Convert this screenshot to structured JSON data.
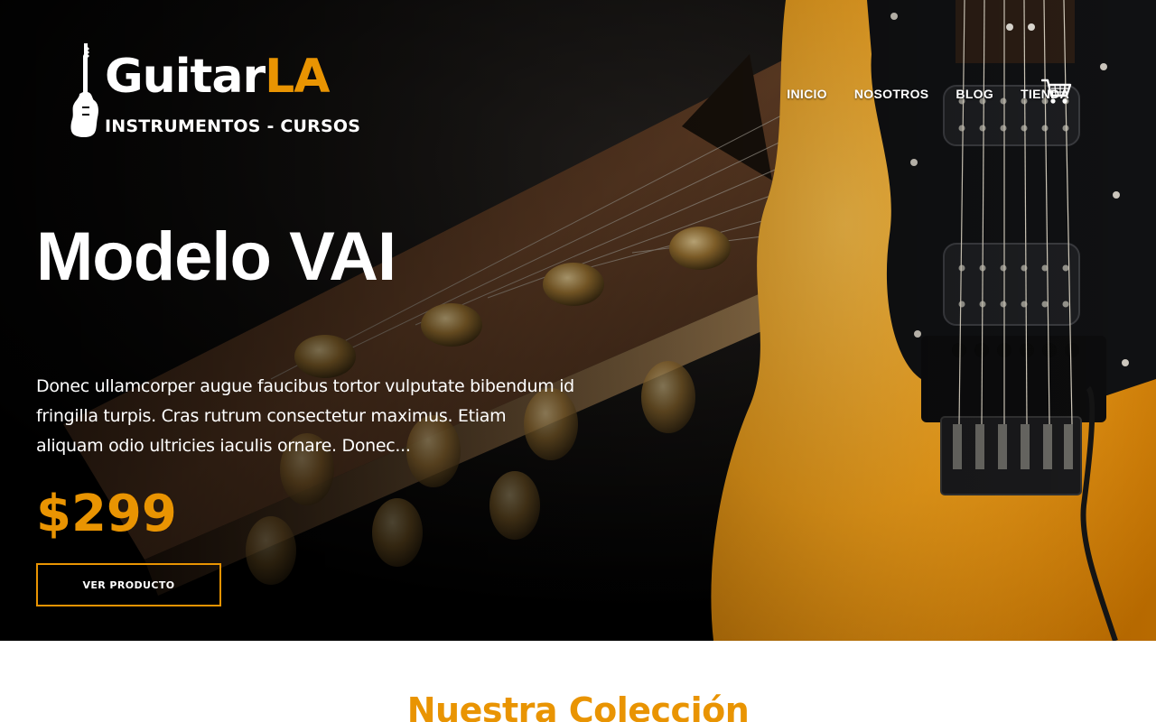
{
  "brand": {
    "name_main": "Guitar",
    "name_accent": "LA",
    "tagline": "INSTRUMENTOS - CURSOS",
    "accent_color": "#e99402",
    "logo_icon": "electric-guitar-icon"
  },
  "nav": {
    "items": [
      {
        "label": "INICIO"
      },
      {
        "label": "NOSOTROS"
      },
      {
        "label": "BLOG"
      },
      {
        "label": "TIENDA"
      }
    ],
    "cart_icon": "shopping-cart-icon"
  },
  "hero": {
    "title": "Modelo VAI",
    "description": "Donec ullamcorper augue faucibus tortor vulputate bibendum id fringilla turpis. Cras rutrum consectetur maximus. Etiam aliquam odio ultricies iaculis ornare. Donec...",
    "price": "$299",
    "button_label": "VER PRODUCTO"
  },
  "collection": {
    "title": "Nuestra Colección"
  }
}
